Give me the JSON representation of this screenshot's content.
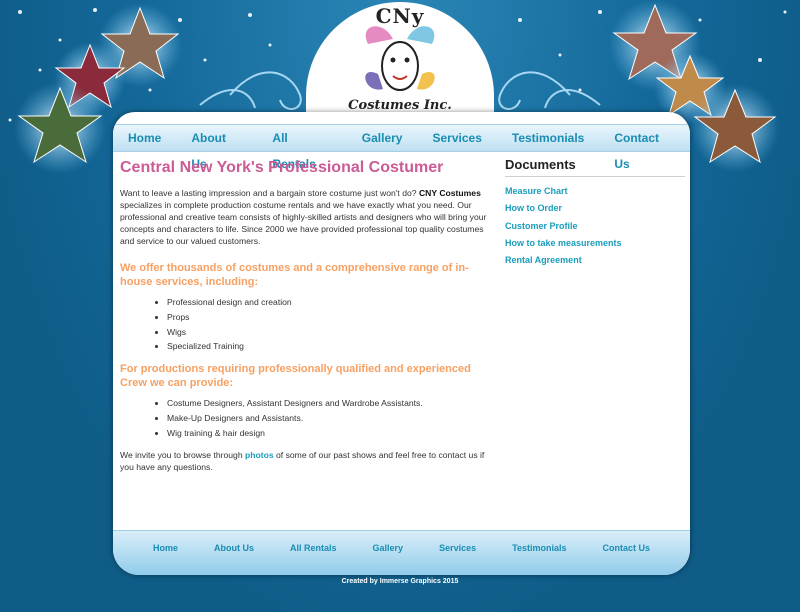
{
  "header": {
    "logo_line1": "CNy",
    "logo_line2": "Costumes Inc."
  },
  "nav": [
    "Home",
    "About Us",
    "All Rentals",
    "Gallery",
    "Services",
    "Testimonials",
    "Contact Us"
  ],
  "main": {
    "title": "Central New York's Professional Costumer",
    "intro_before": "Want to leave a lasting impression and a bargain store costume just won't do? ",
    "intro_bold": "CNY Costumes",
    "intro_after": " specializes in complete production costume rentals and we have exactly what you need. Our professional and creative team consists of highly-skilled artists and designers who will bring your concepts and characters to life. Since 2000 we have provided professional top quality costumes and service to our valued customers.",
    "section1_heading": "We offer thousands of costumes and a comprehensive range of in-house services, including:",
    "section1_items": [
      "Professional design and creation",
      "Props",
      "Wigs",
      "Specialized Training"
    ],
    "section2_heading": "For productions requiring professionally qualified and experienced Crew we can provide:",
    "section2_items": [
      "Costume Designers, Assistant Designers and Wardrobe Assistants.",
      "Make-Up Designers and Assistants.",
      "Wig training & hair design"
    ],
    "closing_before": "We invite you to browse through ",
    "closing_link": "photos",
    "closing_after": " of some of our past shows and feel free to contact us if you have any questions."
  },
  "sidebar": {
    "title": "Documents",
    "items": [
      "Measure Chart",
      "How to Order",
      "Customer Profile",
      "How to take measurements",
      "Rental Agreement"
    ]
  },
  "footer": {
    "nav": [
      "Home",
      "About Us",
      "All Rentals",
      "Gallery",
      "Services",
      "Testimonials",
      "Contact Us"
    ],
    "credit": "Created by Immerse Graphics 2015"
  },
  "colors": {
    "background": "#0e5b86",
    "title": "#cc5b95",
    "section_heading": "#f7a062",
    "link": "#1a9dbb"
  }
}
